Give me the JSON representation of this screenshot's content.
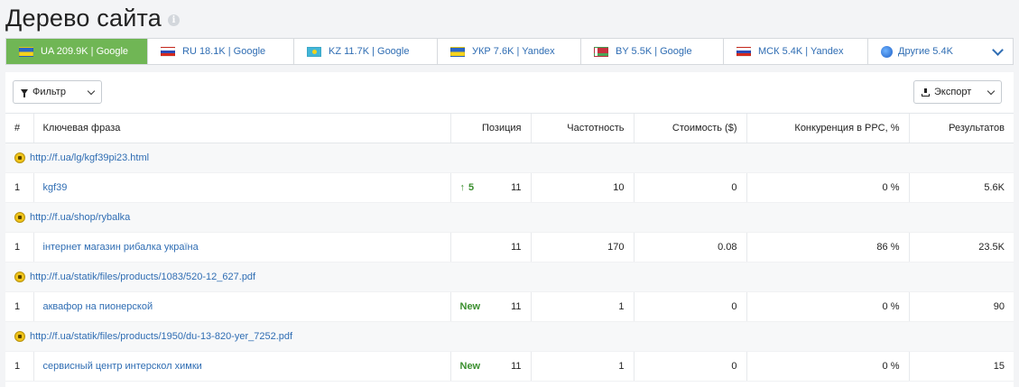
{
  "page": {
    "title": "Дерево сайта"
  },
  "tabs": [
    {
      "label": "UA 209.9K | Google",
      "flag": "ua",
      "active": true
    },
    {
      "label": "RU 18.1K | Google",
      "flag": "ru",
      "active": false
    },
    {
      "label": "KZ 11.7K | Google",
      "flag": "kz",
      "active": false
    },
    {
      "label": "УКР 7.6K | Yandex",
      "flag": "ua",
      "active": false
    },
    {
      "label": "BY 5.5K | Google",
      "flag": "by",
      "active": false
    },
    {
      "label": "МСК 5.4K | Yandex",
      "flag": "ru",
      "active": false
    },
    {
      "label": "Другие 5.4K",
      "flag": "globe",
      "active": false
    }
  ],
  "toolbar": {
    "filter_label": "Фильтр",
    "export_label": "Экспорт"
  },
  "table": {
    "headers": {
      "num": "#",
      "phrase": "Ключевая фраза",
      "position": "Позиция",
      "frequency": "Частотность",
      "cost": "Стоимость ($)",
      "competition": "Конкуренция в PPC, %",
      "results": "Результатов"
    },
    "groups": [
      {
        "url": "http://f.ua/lg/kgf39pi23.html",
        "rows": [
          {
            "num": "1",
            "phrase": "kgf39",
            "change": "5",
            "change_type": "up",
            "position": "11",
            "frequency": "10",
            "cost": "0",
            "competition": "0 %",
            "results": "5.6K"
          }
        ]
      },
      {
        "url": "http://f.ua/shop/rybalka",
        "rows": [
          {
            "num": "1",
            "phrase": "інтернет магазин рибалка україна",
            "change": "",
            "change_type": "",
            "position": "11",
            "frequency": "170",
            "cost": "0.08",
            "competition": "86 %",
            "results": "23.5K"
          }
        ]
      },
      {
        "url": "http://f.ua/statik/files/products/1083/520-12_627.pdf",
        "rows": [
          {
            "num": "1",
            "phrase": "аквафор на пионерской",
            "change": "New",
            "change_type": "new",
            "position": "11",
            "frequency": "1",
            "cost": "0",
            "competition": "0 %",
            "results": "90"
          }
        ]
      },
      {
        "url": "http://f.ua/statik/files/products/1950/du-13-820-yer_7252.pdf",
        "rows": [
          {
            "num": "1",
            "phrase": "сервисный центр интерскол химки",
            "change": "New",
            "change_type": "new",
            "position": "11",
            "frequency": "1",
            "cost": "0",
            "competition": "0 %",
            "results": "15"
          }
        ]
      }
    ]
  }
}
